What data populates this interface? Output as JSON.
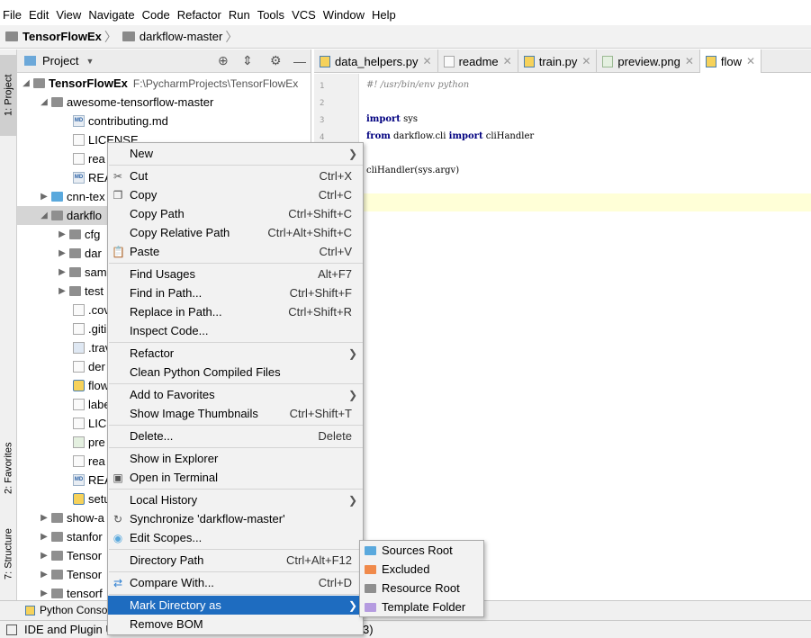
{
  "menubar": [
    "File",
    "Edit",
    "View",
    "Navigate",
    "Code",
    "Refactor",
    "Run",
    "Tools",
    "VCS",
    "Window",
    "Help"
  ],
  "breadcrumb": {
    "project": "TensorFlowEx",
    "folder": "darkflow-master"
  },
  "side_tabs": {
    "project": "1: Project",
    "favorites": "2: Favorites",
    "structure": "7: Structure"
  },
  "project_panel": {
    "title": "Project",
    "tree": [
      {
        "label": "TensorFlowEx",
        "path": "F:\\PycharmProjects\\TensorFlowEx"
      },
      {
        "label": "awesome-tensorflow-master"
      },
      {
        "label": "contributing.md"
      },
      {
        "label": "LICENSE"
      },
      {
        "label": "rea"
      },
      {
        "label": "REA"
      },
      {
        "label": "cnn-tex"
      },
      {
        "label": "darkflo"
      },
      {
        "label": "cfg"
      },
      {
        "label": "dar"
      },
      {
        "label": "sam"
      },
      {
        "label": "test"
      },
      {
        "label": ".cov"
      },
      {
        "label": ".giti"
      },
      {
        "label": ".trav"
      },
      {
        "label": "der"
      },
      {
        "label": "flow"
      },
      {
        "label": "labe"
      },
      {
        "label": "LICI"
      },
      {
        "label": "pre"
      },
      {
        "label": "rea"
      },
      {
        "label": "REA"
      },
      {
        "label": "setu"
      },
      {
        "label": "show-a"
      },
      {
        "label": "stanfor"
      },
      {
        "label": "Tensor"
      },
      {
        "label": "Tensor"
      },
      {
        "label": "tensorf"
      }
    ]
  },
  "editor_tabs": [
    {
      "label": "data_helpers.py"
    },
    {
      "label": "readme"
    },
    {
      "label": "train.py"
    },
    {
      "label": "preview.png"
    },
    {
      "label": "flow"
    }
  ],
  "editor": {
    "line_numbers": [
      "1",
      "2",
      "3",
      "4",
      "5",
      "6"
    ],
    "lines": [
      {
        "cm": "#! /usr/bin/env python"
      },
      {},
      {
        "kw1": "import",
        "rest": " sys"
      },
      {
        "kw1": "from",
        "mid": " darkflow.cli ",
        "kw2": "import",
        "rest": " cliHandler"
      },
      {},
      {
        "rest": "cliHandler(sys.argv)"
      }
    ]
  },
  "context_menu": {
    "items": [
      {
        "label": "New",
        "submenu": true
      },
      {
        "label": "Cut",
        "shortcut": "Ctrl+X",
        "icon": "scissors-icon"
      },
      {
        "label": "Copy",
        "shortcut": "Ctrl+C",
        "icon": "copy-icon"
      },
      {
        "label": "Copy Path",
        "shortcut": "Ctrl+Shift+C"
      },
      {
        "label": "Copy Relative Path",
        "shortcut": "Ctrl+Alt+Shift+C"
      },
      {
        "label": "Paste",
        "shortcut": "Ctrl+V",
        "icon": "paste-icon"
      },
      {
        "label": "Find Usages",
        "shortcut": "Alt+F7"
      },
      {
        "label": "Find in Path...",
        "shortcut": "Ctrl+Shift+F"
      },
      {
        "label": "Replace in Path...",
        "shortcut": "Ctrl+Shift+R"
      },
      {
        "label": "Inspect Code..."
      },
      {
        "label": "Refactor",
        "submenu": true
      },
      {
        "label": "Clean Python Compiled Files"
      },
      {
        "label": "Add to Favorites",
        "submenu": true
      },
      {
        "label": "Show Image Thumbnails",
        "shortcut": "Ctrl+Shift+T"
      },
      {
        "label": "Delete...",
        "shortcut": "Delete"
      },
      {
        "label": "Show in Explorer"
      },
      {
        "label": "Open in Terminal",
        "icon": "terminal-icon"
      },
      {
        "label": "Local History",
        "submenu": true
      },
      {
        "label": "Synchronize 'darkflow-master'",
        "icon": "sync-icon"
      },
      {
        "label": "Edit Scopes...",
        "icon": "scope-icon"
      },
      {
        "label": "Directory Path",
        "shortcut": "Ctrl+Alt+F12"
      },
      {
        "label": "Compare With...",
        "shortcut": "Ctrl+D",
        "icon": "compare-icon"
      },
      {
        "label": "Mark Directory as",
        "submenu": true,
        "highlighted": true
      },
      {
        "label": "Remove BOM"
      }
    ]
  },
  "submenu": {
    "items": [
      {
        "label": "Sources Root",
        "color": "#5aa9dd"
      },
      {
        "label": "Excluded",
        "color": "#f08a4b"
      },
      {
        "label": "Resource Root",
        "color": "#8f8f8f"
      },
      {
        "label": "Template Folder",
        "color": "#b59be0"
      }
    ]
  },
  "bottom": {
    "python_console": "Python Conso",
    "status": "IDE and Plugin U",
    "status_tail": "3)"
  }
}
